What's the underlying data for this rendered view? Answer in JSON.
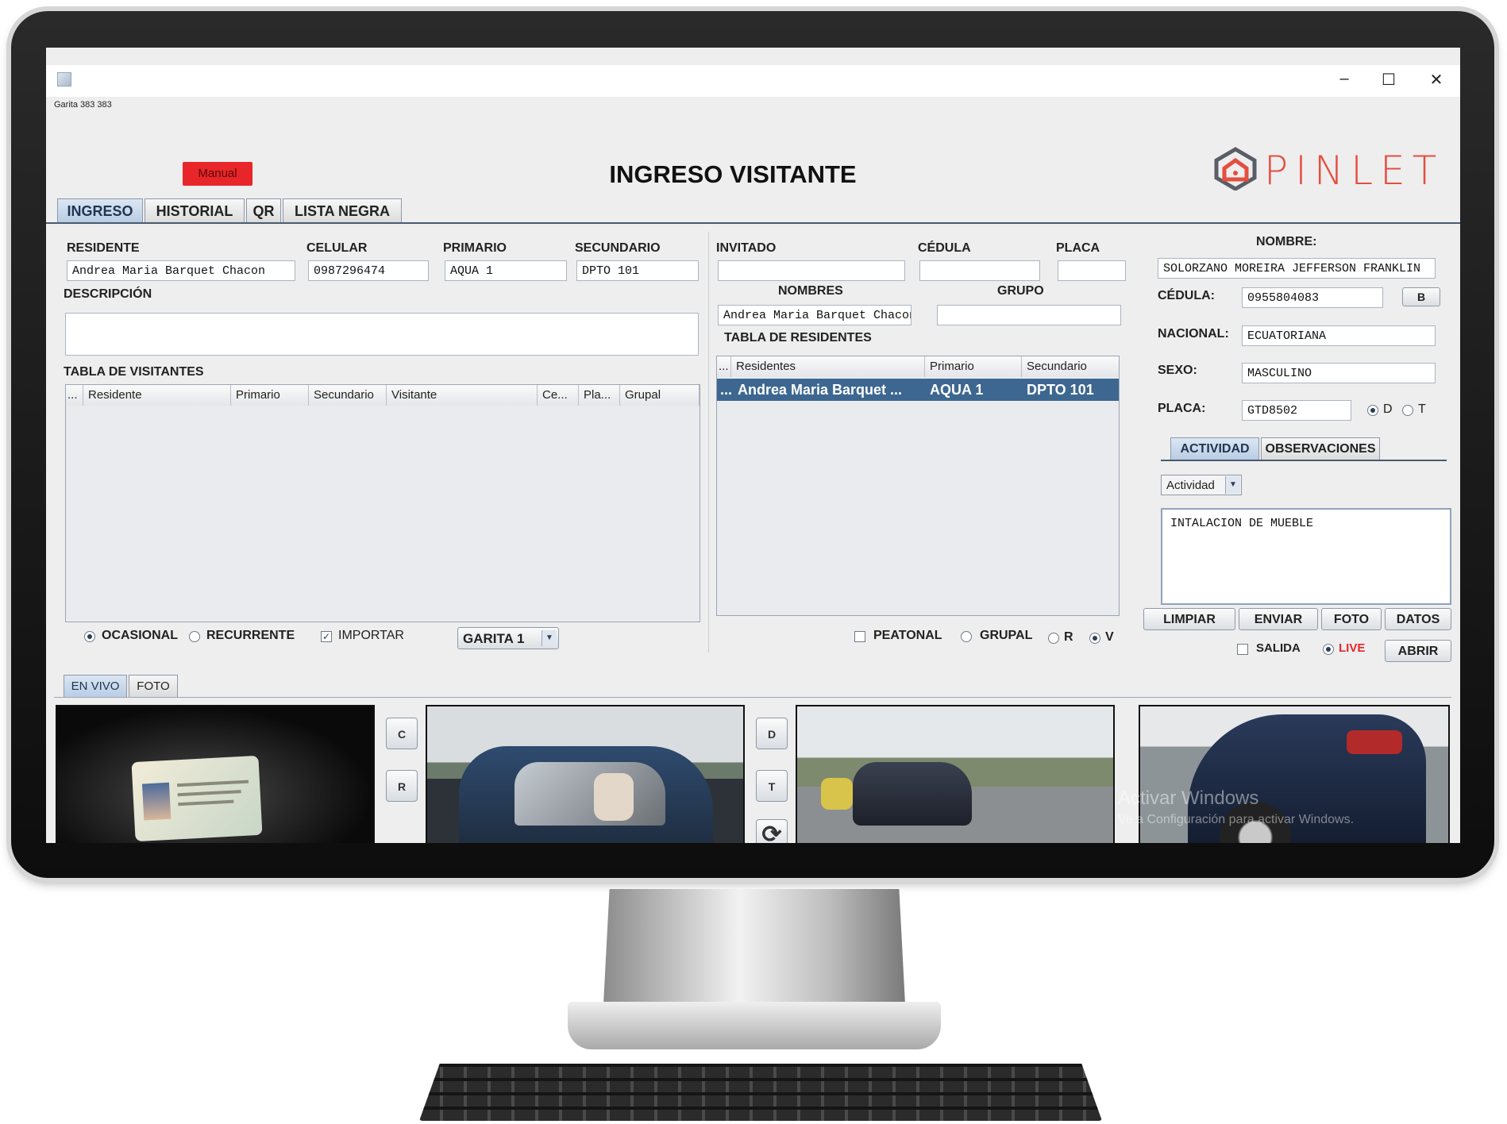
{
  "window": {
    "title_small": "Garita  383  383",
    "controls": {
      "minimize": "–",
      "maximize": "☐",
      "close": "✕"
    }
  },
  "header": {
    "mode_badge": "Manual",
    "title": "INGRESO VISITANTE",
    "logo_text": "PINLET"
  },
  "tabs": [
    "INGRESO",
    "HISTORIAL",
    "QR",
    "LISTA NEGRA"
  ],
  "resident_form": {
    "residente_label": "RESIDENTE",
    "residente_value": "Andrea Maria Barquet Chacon",
    "celular_label": "CELULAR",
    "celular_value": "0987296474",
    "primario_label": "PRIMARIO",
    "primario_value": "AQUA 1",
    "secundario_label": "SECUNDARIO",
    "secundario_value": "DPTO 101",
    "descripcion_label": "DESCRIPCIÓN",
    "descripcion_value": ""
  },
  "visitors_table": {
    "title": "TABLA DE VISITANTES",
    "columns": [
      "...",
      "Residente",
      "Primario",
      "Secundario",
      "Visitante",
      "Ce...",
      "Pla...",
      "Grupal"
    ],
    "rows": []
  },
  "guest_form": {
    "invitado_label": "INVITADO",
    "invitado_value": "",
    "cedula_label": "CÉDULA",
    "cedula_value": "",
    "placa_label": "PLACA",
    "placa_value": "",
    "nombres_label": "NOMBRES",
    "nombres_value": "Andrea Maria Barquet Chacon",
    "grupo_label": "GRUPO",
    "grupo_value": ""
  },
  "residents_table": {
    "title": "TABLA DE RESIDENTES",
    "columns": [
      "...",
      "Residentes",
      "Primario",
      "Secundario"
    ],
    "rows": [
      {
        "prefix": "...",
        "residente": "Andrea Maria Barquet ...",
        "primario": "AQUA 1",
        "secundario": "DPTO 101"
      }
    ]
  },
  "person": {
    "nombre_label": "NOMBRE:",
    "nombre_value": "SOLORZANO MOREIRA JEFFERSON FRANKLIN",
    "cedula_label": "CÉDULA:",
    "cedula_value": "0955804083",
    "b_button": "B",
    "nacional_label": "NACIONAL:",
    "nacional_value": "ECUATORIANA",
    "sexo_label": "SEXO:",
    "sexo_value": "MASCULINO",
    "placa_label": "PLACA:",
    "placa_value": "GTD8502",
    "radio_d": "D",
    "radio_t": "T"
  },
  "activity": {
    "tabs": [
      "ACTIVIDAD",
      "OBSERVACIONES"
    ],
    "select_value": "Actividad",
    "text": "INTALACION  DE MUEBLE"
  },
  "action_buttons": {
    "limpiar": "LIMPIAR",
    "enviar": "ENVIAR",
    "foto": "FOTO",
    "datos": "DATOS",
    "abrir": "ABRIR"
  },
  "options": {
    "ocasional": "OCASIONAL",
    "recurrente": "RECURRENTE",
    "importar": "IMPORTAR",
    "garita": "GARITA 1",
    "peatonal": "PEATONAL",
    "grupal": "GRUPAL",
    "r": "R",
    "v": "V",
    "salida": "SALIDA",
    "live": "LIVE"
  },
  "camera_tabs": [
    "EN VIVO",
    "FOTO"
  ],
  "camera_side_buttons": {
    "c": "C",
    "r": "R",
    "d": "D",
    "t": "T"
  },
  "watermark": {
    "line1": "Activar Windows",
    "line2": "Ve a Configuración para activar Windows."
  },
  "colors": {
    "accent_red": "#e8262a",
    "selection": "#3d6790",
    "logo": "#e44e3f"
  },
  "icons": {
    "refresh": "refresh-icon",
    "logo": "pinlet-house-icon",
    "dropdown": "chevron-down-icon"
  }
}
